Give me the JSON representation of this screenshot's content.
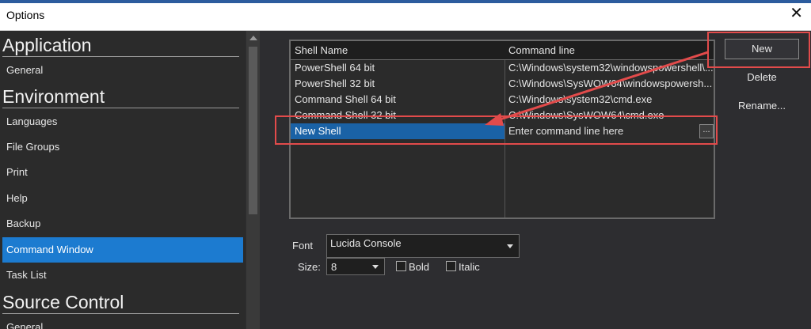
{
  "window": {
    "title": "Options",
    "close_icon": "close-icon",
    "close_glyph": "✕"
  },
  "sidebar": {
    "sections": [
      {
        "title": "Application",
        "items": [
          "General"
        ]
      },
      {
        "title": "Environment",
        "items": [
          "Languages",
          "File Groups",
          "Print",
          "Help",
          "Backup",
          "Command Window",
          "Task List"
        ]
      },
      {
        "title": "Source Control",
        "items": [
          "General"
        ]
      }
    ],
    "selected_item": "Command Window"
  },
  "shells_table": {
    "columns": [
      "Shell Name",
      "Command line"
    ],
    "rows": [
      {
        "name": "PowerShell 64 bit",
        "command": "C:\\Windows\\system32\\windowspowershell\\..."
      },
      {
        "name": "PowerShell 32 bit",
        "command": "C:\\Windows\\SysWOW64\\windowspowersh..."
      },
      {
        "name": "Command Shell 64 bit",
        "command": "C:\\Windows\\system32\\cmd.exe"
      },
      {
        "name": "Command Shell 32 bit",
        "command": "C:\\Windows\\SysWOW64\\cmd.exe"
      }
    ],
    "new_row": {
      "name": "New Shell",
      "command_placeholder": "Enter command line here",
      "browse_label": "..."
    }
  },
  "buttons": {
    "new": "New",
    "delete": "Delete",
    "rename": "Rename..."
  },
  "font_settings": {
    "font_label": "Font",
    "font_value": "Lucida Console",
    "size_label": "Size:",
    "size_value": "8",
    "bold_label": "Bold",
    "italic_label": "Italic",
    "bold_checked": false,
    "italic_checked": false
  },
  "colors": {
    "accent": "#1c7bd0",
    "selection": "#1a62a6",
    "annotation": "#e24b4b"
  }
}
